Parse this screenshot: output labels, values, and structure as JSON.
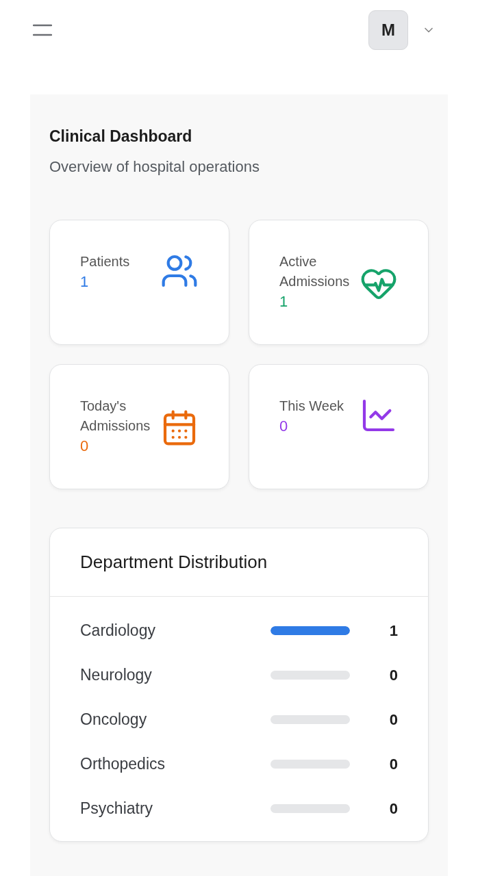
{
  "header": {
    "avatar": "M"
  },
  "page": {
    "title": "Clinical Dashboard",
    "subtitle": "Overview of hospital operations"
  },
  "stats": [
    {
      "label": "Patients",
      "value": "1",
      "kind": "users",
      "color": "#2f7be5"
    },
    {
      "label": "Active Admissions",
      "value": "1",
      "kind": "heart",
      "color": "#16a36a"
    },
    {
      "label": "Today's Admissions",
      "value": "0",
      "kind": "calendar",
      "color": "#ea6a0c"
    },
    {
      "label": "This Week",
      "value": "0",
      "kind": "trend",
      "color": "#9339e8"
    }
  ],
  "departments": {
    "title": "Department Distribution",
    "items": [
      {
        "name": "Cardiology",
        "level": 1,
        "count": "1"
      },
      {
        "name": "Neurology",
        "level": 0,
        "count": "0"
      },
      {
        "name": "Oncology",
        "level": 0,
        "count": "0"
      },
      {
        "name": "Orthopedics",
        "level": 0,
        "count": "0"
      },
      {
        "name": "Psychiatry",
        "level": 0,
        "count": "0"
      }
    ]
  }
}
